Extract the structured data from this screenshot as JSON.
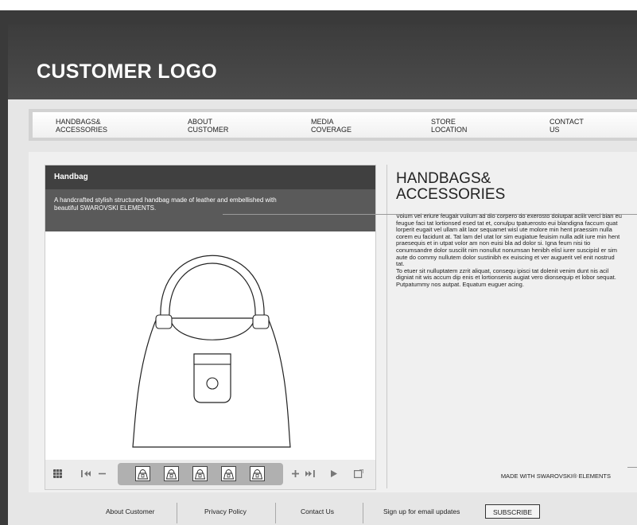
{
  "header": {
    "logo": "CUSTOMER LOGO"
  },
  "nav": {
    "items": [
      {
        "label": "HANDBAGS&\nACCESSORIES"
      },
      {
        "label": "ABOUT\nCUSTOMER"
      },
      {
        "label": "MEDIA\nCOVERAGE"
      },
      {
        "label": "STORE\nLOCATION"
      },
      {
        "label": "CONTACT\nUS"
      }
    ]
  },
  "product": {
    "title": "Handbag",
    "description": "A handcrafted stylish structured handbag made of leather and embellished with beautiful SWAROVSKI ELEMENTS."
  },
  "toolbar": {
    "icons": [
      "grid-icon",
      "first-icon",
      "minus-icon",
      "plus-icon",
      "last-icon",
      "play-icon",
      "fullscreen-icon"
    ],
    "thumbnail_count": 5
  },
  "category": {
    "title": "HANDBAGS&\nACCESSORIES",
    "paragraph1": "Volum vel eriure feugait vullum ad dio corpero do exerosto dolutpat acilit verci blan eu feugue faci tat lortionsed esed tat et, conulpu tpatuerosto eui blandigna faccum quat lorperit eugait vel ullam alit laor sequamet wisl ute molore min hent praessim nulla corem eu facidunt at. Tat lam del utat lor sim eugiatue feuisim nulla adit iure min hent praesequis et in utpat volor am non euisi bla ad dolor si. Igna feum nisi tio conumsandre dolor suscilit nim nonullut nonumsan henibh elisl iurer suscipisl er sim aute do commy nullutem dolor sustinibh ex euiscing et ver auguerit vel enit nostrud tat.",
    "paragraph2": "To etuer sit nulluptatem zzrit aliquat, consequ ipisci tat dolenit venim dunt nis acil digniat nit wis accum dip enis et lortionsenis augiat vero dionsequip et lobor sequat. Putpatummy nos autpat. Equatum euguer acing.",
    "made_with": "MADE WITH SWAROVSKI® ELEMENTS"
  },
  "footer": {
    "about": "About Customer",
    "privacy": "Privacy Policy",
    "contact": "Contact Us",
    "signup": "Sign up for email updates",
    "subscribe": "SUBSCRIBE"
  }
}
